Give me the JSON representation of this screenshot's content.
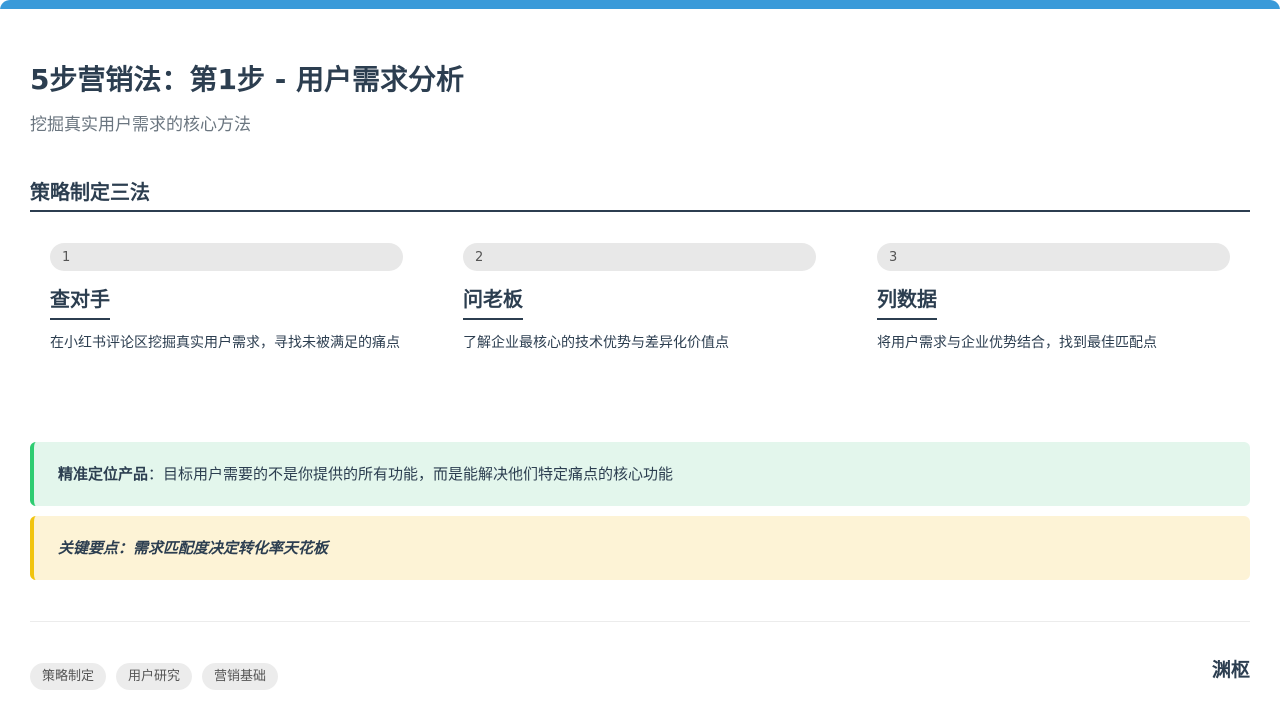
{
  "header": {
    "title": "5步营销法：第1步 - 用户需求分析",
    "subtitle": "挖掘真实用户需求的核心方法"
  },
  "section": {
    "heading": "策略制定三法"
  },
  "steps": [
    {
      "number": "1",
      "title": "查对手",
      "description": "在小红书评论区挖掘真实用户需求，寻找未被满足的痛点"
    },
    {
      "number": "2",
      "title": "问老板",
      "description": "了解企业最核心的技术优势与差异化价值点"
    },
    {
      "number": "3",
      "title": "列数据",
      "description": "将用户需求与企业优势结合，找到最佳匹配点"
    }
  ],
  "callouts": {
    "positioning": {
      "label": "精准定位产品",
      "separator": "：",
      "text": "目标用户需要的不是你提供的所有功能，而是能解决他们特定痛点的核心功能"
    },
    "key_point": {
      "text": "关键要点：需求匹配度决定转化率天花板"
    }
  },
  "footer": {
    "tags": [
      "策略制定",
      "用户研究",
      "营销基础"
    ],
    "brand": "渊枢"
  },
  "colors": {
    "accent": "#3a9ad9",
    "text": "#2c3e50",
    "green_callout_border": "#2ecc71",
    "yellow_callout_border": "#f1c40f"
  }
}
